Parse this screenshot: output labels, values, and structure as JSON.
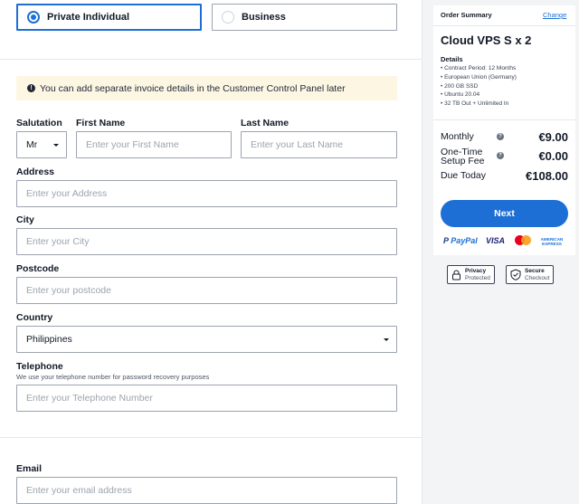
{
  "customer_type": {
    "options": [
      {
        "label": "Private Individual",
        "selected": true
      },
      {
        "label": "Business",
        "selected": false
      }
    ]
  },
  "notice": {
    "text": "You can add separate invoice details in the Customer Control Panel later",
    "icon": "info-icon"
  },
  "form": {
    "salutation": {
      "label": "Salutation",
      "value": "Mr"
    },
    "first_name": {
      "label": "First Name",
      "placeholder": "Enter your First Name"
    },
    "last_name": {
      "label": "Last Name",
      "placeholder": "Enter your Last Name"
    },
    "address": {
      "label": "Address",
      "placeholder": "Enter your Address"
    },
    "city": {
      "label": "City",
      "placeholder": "Enter your City"
    },
    "postcode": {
      "label": "Postcode",
      "placeholder": "Enter your postcode"
    },
    "country": {
      "label": "Country",
      "value": "Philippines"
    },
    "telephone": {
      "label": "Telephone",
      "hint": "We use your telephone number for password recovery purposes",
      "placeholder": "Enter your Telephone Number"
    },
    "email": {
      "label": "Email",
      "placeholder": "Enter your email address"
    }
  },
  "order_summary": {
    "title": "Order Summary",
    "change_label": "Change",
    "product": "Cloud VPS S x 2",
    "details_heading": "Details",
    "details": [
      "Contract Period: 12 Months",
      "European Union (Germany)",
      "200 GB SSD",
      "Ubuntu 20.04",
      "32 TB Out + Unlimited In"
    ],
    "monthly_label": "Monthly",
    "monthly_value": "€9.00",
    "setup_label_1": "One-Time",
    "setup_label_2": "Setup Fee",
    "setup_value": "€0.00",
    "due_label": "Due Today",
    "due_value": "€108.00",
    "next_label": "Next",
    "payment_methods": [
      "PayPal",
      "VISA",
      "mastercard",
      "AMERICAN EXPRESS"
    ],
    "privacy_1": "Privacy",
    "privacy_2": "Protected",
    "secure_1": "Secure",
    "secure_2": "Checkout"
  },
  "colors": {
    "accent": "#1d6fd6",
    "notice_bg": "#fdf6e3",
    "sidebar_bg": "#f3f4f6"
  }
}
